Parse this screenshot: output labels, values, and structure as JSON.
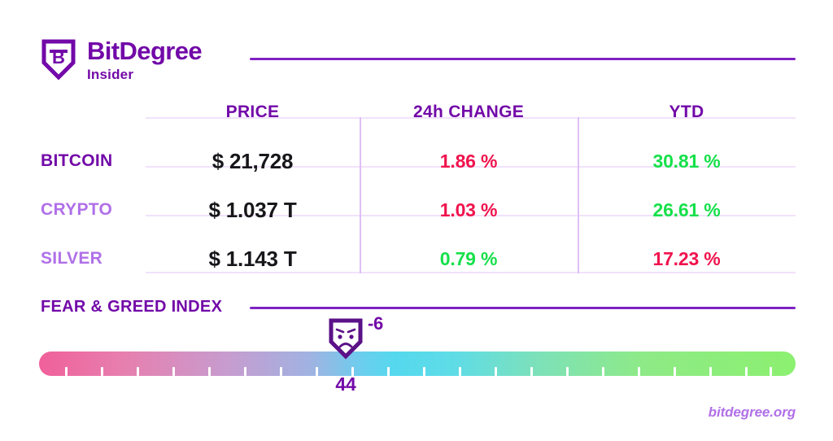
{
  "brand": {
    "name": "BitDegree",
    "sub": "Insider",
    "logo_icon": "shield-b-logo-icon",
    "color": "#7209A8"
  },
  "table": {
    "headers": {
      "asset": "",
      "price": "PRICE",
      "change": "24h CHANGE",
      "ytd": "YTD"
    },
    "rows": [
      {
        "name": "BITCOIN",
        "name_color": "#7209A8",
        "price": "$ 21,728",
        "change": "1.86 %",
        "change_dir": "down",
        "ytd": "30.81 %",
        "ytd_dir": "up"
      },
      {
        "name": "CRYPTO",
        "name_color": "#B070E8",
        "price": "$ 1.037 T",
        "change": "1.03 %",
        "change_dir": "down",
        "ytd": "26.61 %",
        "ytd_dir": "up"
      },
      {
        "name": "SILVER",
        "name_color": "#B070E8",
        "price": "$ 1.143 T",
        "change": "0.79 %",
        "change_dir": "up",
        "ytd": "17.23 %",
        "ytd_dir": "down"
      }
    ],
    "colors": {
      "up": "#16E04A",
      "down": "#F0134D",
      "price": "#17161A",
      "rule": "#7F22C4",
      "hline": "#F1E2FB",
      "vline": "#DFBEF5"
    }
  },
  "fear_greed": {
    "title": "FEAR & GREED INDEX",
    "marker_icon": "sad-face-shield-marker-icon",
    "marker_delta": "-6",
    "index_value": "44",
    "scale_min": 0,
    "scale_max": 100,
    "gradient_stops": [
      "#F0609A",
      "#C79CCF",
      "#55D8EE",
      "#8CF070"
    ],
    "tick_count": 21
  },
  "footer": {
    "site": "bitdegree.org"
  }
}
